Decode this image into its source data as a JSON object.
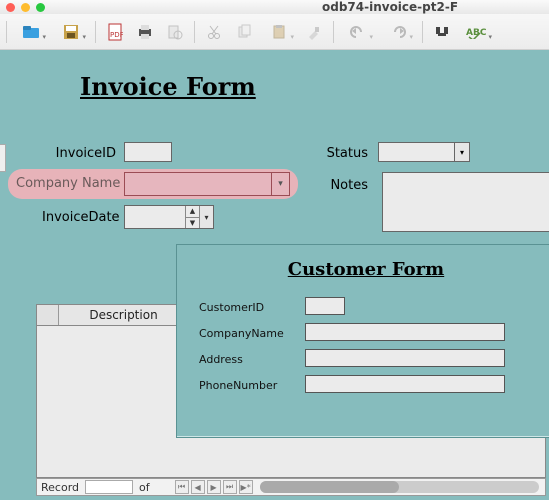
{
  "window": {
    "title": "odb74-invoice-pt2-F"
  },
  "toolbar_icons": [
    "open",
    "save",
    "divider",
    "pdf",
    "print",
    "preview",
    "divider",
    "cut",
    "copy",
    "paste",
    "paintfmt",
    "divider",
    "undo",
    "redo",
    "divider",
    "find",
    "spellcheck"
  ],
  "invoice_form": {
    "title": "Invoice Form",
    "labels": {
      "invoice_id": "InvoiceID",
      "company_name": "Company Name",
      "invoice_date": "InvoiceDate",
      "status": "Status",
      "notes": "Notes"
    },
    "values": {
      "invoice_id": "",
      "company_name": "",
      "invoice_date": "",
      "status": "",
      "notes": ""
    }
  },
  "customer_form": {
    "title": "Customer Form",
    "labels": {
      "customer_id": "CustomerID",
      "company_name": "CompanyName",
      "address": "Address",
      "phone": "PhoneNumber"
    },
    "values": {
      "customer_id": "",
      "company_name": "",
      "address": "",
      "phone": ""
    }
  },
  "table": {
    "columns": {
      "description": "Description"
    }
  },
  "record_nav": {
    "label_record": "Record",
    "label_of": "of",
    "current": "",
    "total": ""
  }
}
